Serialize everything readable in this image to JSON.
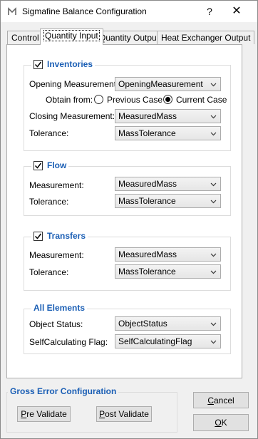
{
  "window": {
    "title": "Sigmafine Balance Configuration",
    "help_label": "?",
    "close_label": "✕"
  },
  "tabs": [
    {
      "label": "Control",
      "active": false
    },
    {
      "label": "Quantity Input",
      "active": true
    },
    {
      "label": "Quantity Output",
      "active": false
    },
    {
      "label": "Heat Exchanger Output",
      "active": false
    }
  ],
  "inventories": {
    "title": "Inventories",
    "checked": true,
    "opening_label": "Opening Measurement:",
    "opening_value": "OpeningMeasurement",
    "obtain_label": "Obtain from:",
    "radio_previous": "Previous Case",
    "radio_current": "Current Case",
    "selected": "Current Case",
    "closing_label": "Closing Measurement:",
    "closing_value": "MeasuredMass",
    "tolerance_label": "Tolerance:",
    "tolerance_value": "MassTolerance"
  },
  "flow": {
    "title": "Flow",
    "checked": true,
    "measurement_label": "Measurement:",
    "measurement_value": "MeasuredMass",
    "tolerance_label": "Tolerance:",
    "tolerance_value": "MassTolerance"
  },
  "transfers": {
    "title": "Transfers",
    "checked": true,
    "measurement_label": "Measurement:",
    "measurement_value": "MeasuredMass",
    "tolerance_label": "Tolerance:",
    "tolerance_value": "MassTolerance"
  },
  "all_elements": {
    "title": "All Elements",
    "status_label": "Object Status:",
    "status_value": "ObjectStatus",
    "flag_label": "SelfCalculating Flag:",
    "flag_value": "SelfCalculatingFlag"
  },
  "gross_error": {
    "title": "Gross Error Configuration",
    "pre_mn": "P",
    "pre_rest": "re Validate",
    "post_mn": "P",
    "post_rest": "ost Validate"
  },
  "buttons": {
    "cancel_mn": "C",
    "cancel_rest": "ancel",
    "ok_mn": "O",
    "ok_rest": "K"
  },
  "colors": {
    "group_title": "#1b5fb5",
    "window_bg": "#f0f0f0"
  }
}
